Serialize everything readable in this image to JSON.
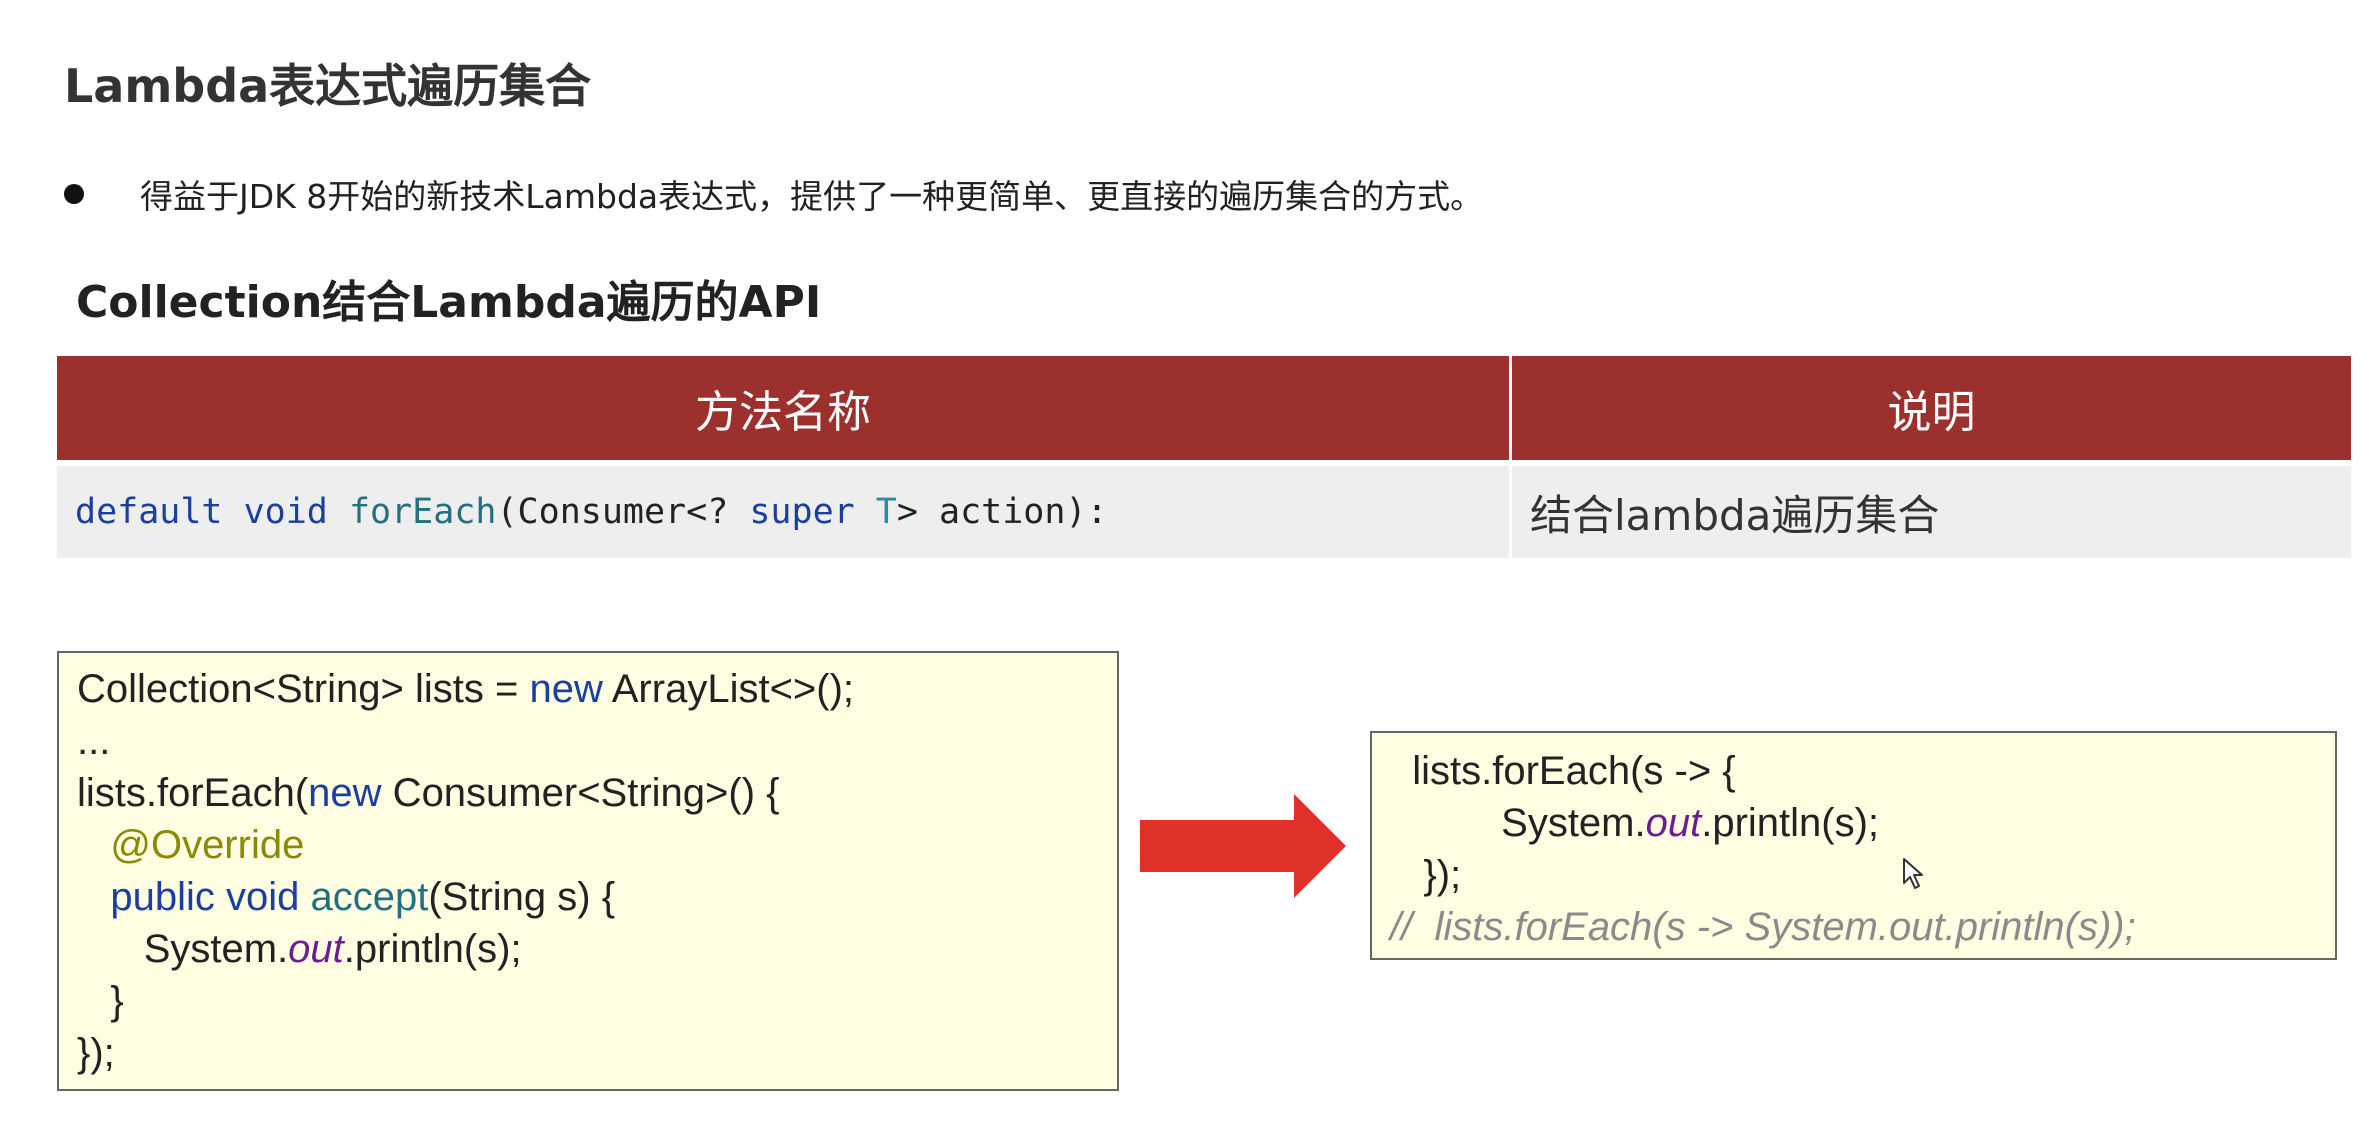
{
  "title": "Lambda表达式遍历集合",
  "bullet": {
    "text": "得益于JDK 8开始的新技术Lambda表达式，提供了一种更简单、更直接的遍历集合的方式。"
  },
  "subtitle": "Collection结合Lambda遍历的API",
  "table": {
    "headers": {
      "method": "方法名称",
      "description": "说明"
    },
    "row": {
      "method_tokens": {
        "t0": "default",
        "t1": " ",
        "t2": "void",
        "t3": " ",
        "t4": "forEach",
        "t5": "(Consumer<? ",
        "t6": "super",
        "t7": " ",
        "t8": "T",
        "t9": "> action):"
      },
      "description": "结合lambda遍历集合"
    }
  },
  "code_left": {
    "l0": {
      "a": "Collection<String> lists = ",
      "b": "new",
      "c": " ArrayList<>();"
    },
    "l1": "...",
    "l2": {
      "a": "lists.forEach(",
      "b": "new",
      "c": " Consumer<String>() {"
    },
    "l3": {
      "indent": "   ",
      "anno": "@Override"
    },
    "l4": {
      "indent": "   ",
      "kw": "public void",
      "sp": " ",
      "fn": "accept",
      "rest": "(String s) {"
    },
    "l5": {
      "indent": "      ",
      "a": "System.",
      "static": "out",
      "c": ".println(s);"
    },
    "l6": "   }",
    "l7": "});"
  },
  "code_right": {
    "l0": "  lists.forEach(s -> {",
    "l1": {
      "indent": "          ",
      "a": "System.",
      "static": "out",
      "c": ".println(s);"
    },
    "l2": "   });",
    "l3": "//  lists.forEach(s -> System.out.println(s));"
  },
  "colors": {
    "table_header_bg": "#9b302c",
    "table_row_bg": "#eeeeee",
    "code_box_bg": "#fffee3",
    "arrow": "#e0302a",
    "keyword": "#1b3f9e",
    "static_field": "#6b1f8f",
    "annotation": "#8a8a00",
    "comment": "#8a8a8a"
  },
  "icons": {
    "bullet": "filled-circle",
    "arrow": "right-arrow-icon",
    "cursor": "mouse-pointer-icon"
  }
}
